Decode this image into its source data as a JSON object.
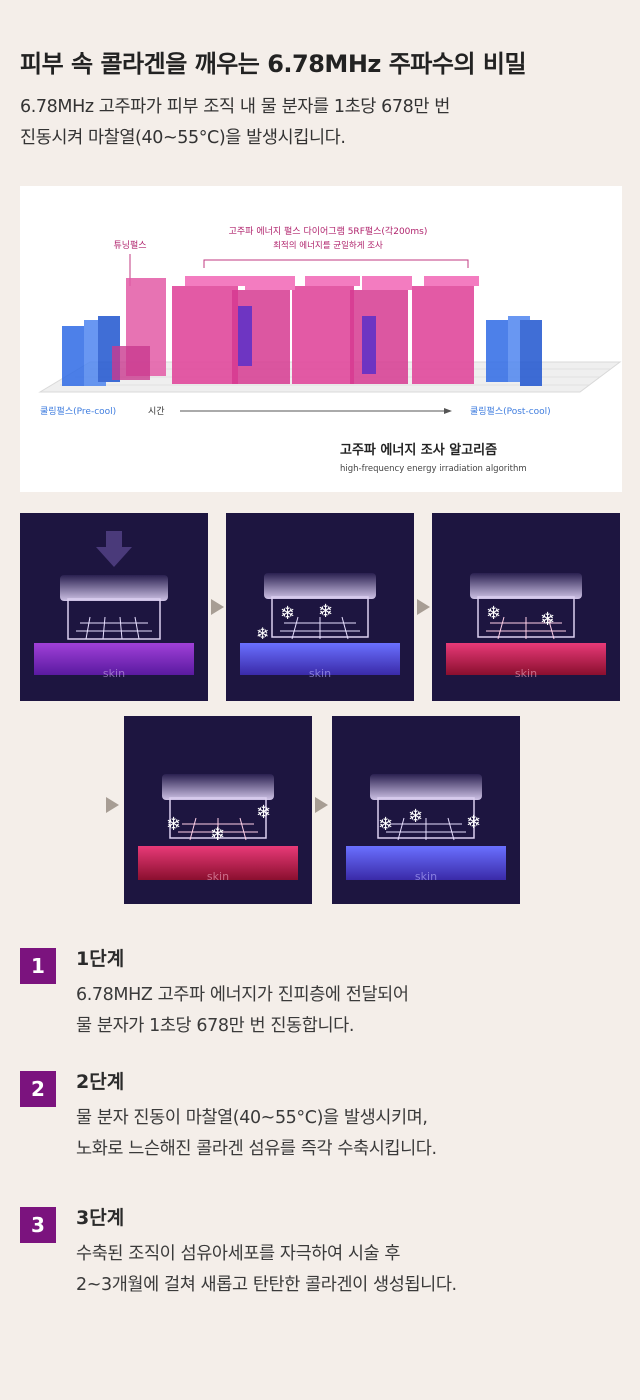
{
  "title": "피부 속 콜라겐을 깨우는 6.78MHz 주파수의 비밀",
  "intro": [
    "6.78MHz 고주파가 피부 조직 내 물 분자를 1초당 678만 번",
    "진동시켜 마찰열(40~55°C)을 발생시킵니다."
  ],
  "algorithm": {
    "header_line1": "고주파 에너지 펄스 다이어그램 5RF펄스(각200ms)",
    "header_line2": "최적의 에너지를 균일하게 조사",
    "tuning_label": "튜닝펄스",
    "precool_label": "쿨링펄스(Pre-cool)",
    "time_label": "시간",
    "postcool_label": "쿨링펄스(Post-cool)",
    "caption_ko": "고주파 에너지 조사 알고리즘",
    "caption_en": "high-frequency energy irradiation algorithm"
  },
  "panels": [
    {
      "skin": "skin"
    },
    {
      "skin": "skin"
    },
    {
      "skin": "skin"
    },
    {
      "skin": "skin"
    },
    {
      "skin": "skin"
    }
  ],
  "steps": [
    {
      "num": "1",
      "title": "1단계",
      "lines": [
        "6.78MHZ 고주파 에너지가 진피층에 전달되어",
        "물 분자가 1초당 678만 번 진동합니다."
      ]
    },
    {
      "num": "2",
      "title": "2단계",
      "lines": [
        "물 분자 진동이 마찰열(40~55°C)을 발생시키며,",
        "노화로 느슨해진 콜라겐 섬유를 즉각 수축시킵니다."
      ]
    },
    {
      "num": "3",
      "title": "3단계",
      "lines": [
        "수축된 조직이 섬유아세포를 자극하여 시술 후",
        "2~3개월에 걸쳐 새롭고 탄탄한 콜라겐이 생성됩니다."
      ]
    }
  ],
  "colors": {
    "background": "#f4eee9",
    "accent": "#7b137e",
    "rf_pink": "#e0489b",
    "cool_blue": "#2f6be6",
    "panel_bg": "#1d1540"
  }
}
